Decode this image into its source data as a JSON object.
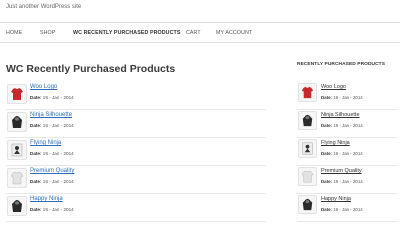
{
  "site": {
    "tagline": "Just another WordPress site"
  },
  "nav": {
    "items": [
      {
        "label": "HOME"
      },
      {
        "label": "SHOP"
      },
      {
        "label": "WC RECENTLY PURCHASED PRODUCTS",
        "current": true
      },
      {
        "label": "CART"
      },
      {
        "label": "MY ACCOUNT"
      }
    ]
  },
  "main": {
    "title": "WC Recently Purchased Products",
    "date_label": "Date:",
    "products": [
      {
        "name": "Woo Logo",
        "date": "19 - Jan - 2014",
        "icon": "red-tshirt-icon",
        "color": "#c8272c"
      },
      {
        "name": "Ninja Silhouette",
        "date": "19 - Jan - 2014",
        "icon": "black-hoodie-icon",
        "color": "#2a2a2a"
      },
      {
        "name": "Flying Ninja",
        "date": "19 - Jan - 2014",
        "icon": "ninja-poster-icon",
        "color": "#3a3a3a"
      },
      {
        "name": "Premium Quality",
        "date": "19 - Jan - 2014",
        "icon": "white-tshirt-icon",
        "color": "#d8d8d8"
      },
      {
        "name": "Happy Ninja",
        "date": "19 - Jan - 2014",
        "icon": "black-hoodie-icon",
        "color": "#2a2a2a"
      }
    ]
  },
  "sidebar": {
    "widget_title": "RECENTLY PURCHASED PRODUCTS",
    "date_label": "Date:",
    "products": [
      {
        "name": "Woo Logo",
        "date": "19 - Jan - 2014"
      },
      {
        "name": "Ninja Silhouette",
        "date": "19 - Jan - 2014"
      },
      {
        "name": "Flying Ninja",
        "date": "19 - Jan - 2014"
      },
      {
        "name": "Premium Quality",
        "date": "19 - Jan - 2014"
      },
      {
        "name": "Happy Ninja",
        "date": "19 - Jan - 2014"
      }
    ]
  }
}
